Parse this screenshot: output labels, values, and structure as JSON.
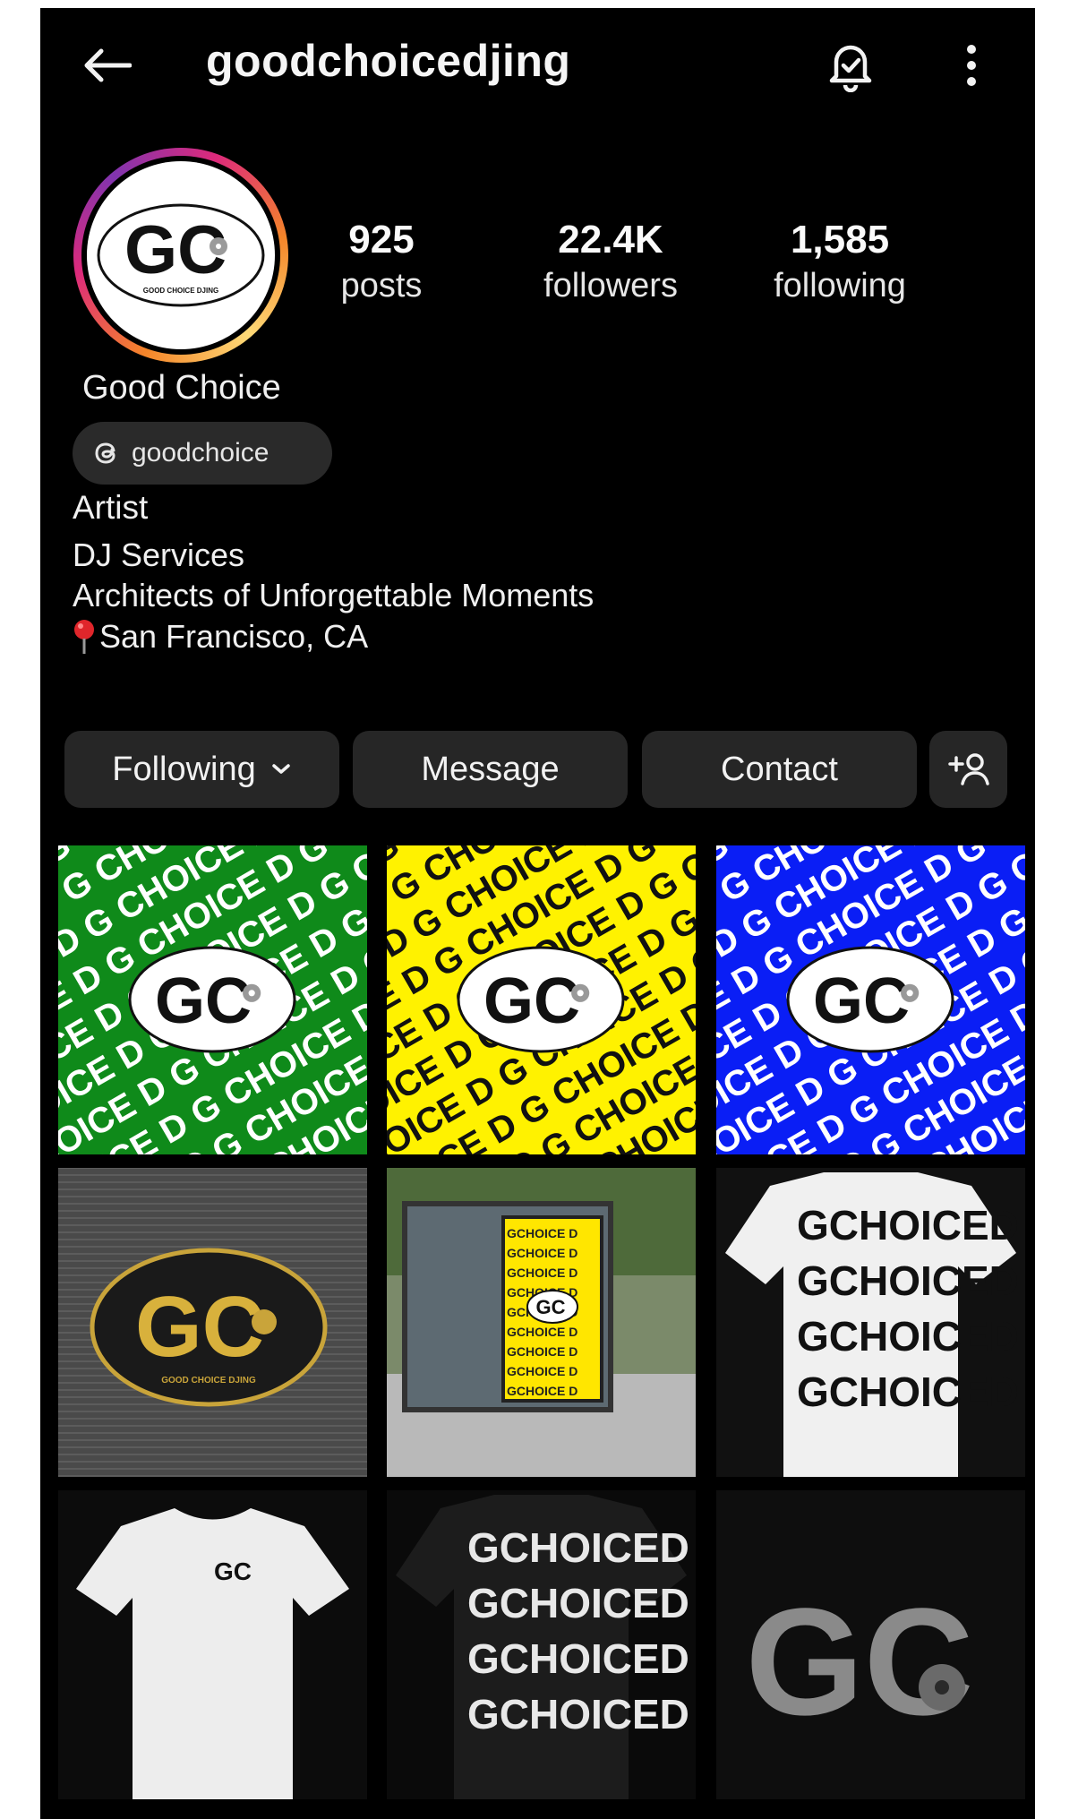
{
  "header": {
    "username": "goodchoicedjing",
    "icons": {
      "back": "arrow-left-icon",
      "notifications": "bell-check-icon",
      "more": "more-vertical-icon"
    }
  },
  "profile": {
    "avatar_logo_text": "GC",
    "avatar_logo_subtext": "GOOD CHOICE DJING",
    "display_name": "Good Choice",
    "threads_handle": "goodchoice",
    "category": "Artist",
    "bio": [
      "DJ Services",
      "Architects of Unforgettable Moments"
    ],
    "location": "San Francisco, CA"
  },
  "stats": [
    {
      "value": "925",
      "label": "posts"
    },
    {
      "value": "22.4K",
      "label": "followers"
    },
    {
      "value": "1,585",
      "label": "following"
    }
  ],
  "actions": {
    "following": "Following",
    "message": "Message",
    "contact": "Contact",
    "add_user_icon": "add-person-icon"
  },
  "grid": [
    {
      "kind": "pattern",
      "bg": "#0f8a1a",
      "fg": "#ffffff",
      "logo": "GC"
    },
    {
      "kind": "pattern",
      "bg": "#fff200",
      "fg": "#111111",
      "logo": "GC"
    },
    {
      "kind": "pattern",
      "bg": "#0a1ef5",
      "fg": "#ffffff",
      "logo": "GC"
    },
    {
      "kind": "patch",
      "logo": "GC",
      "sub": "GOOD CHOICE DJING"
    },
    {
      "kind": "billboard",
      "logo": "GC"
    },
    {
      "kind": "shirt-back-white",
      "word": "CHOICE"
    },
    {
      "kind": "shirt-front-white",
      "logo": "GC"
    },
    {
      "kind": "shirt-back-black",
      "word": "CHOICE"
    },
    {
      "kind": "logo-dark",
      "logo": "GC"
    }
  ],
  "colors": {
    "background": "#000000",
    "button_bg": "#262626",
    "story_ring": [
      "#f58529",
      "#dd2a7b",
      "#8134af"
    ]
  }
}
